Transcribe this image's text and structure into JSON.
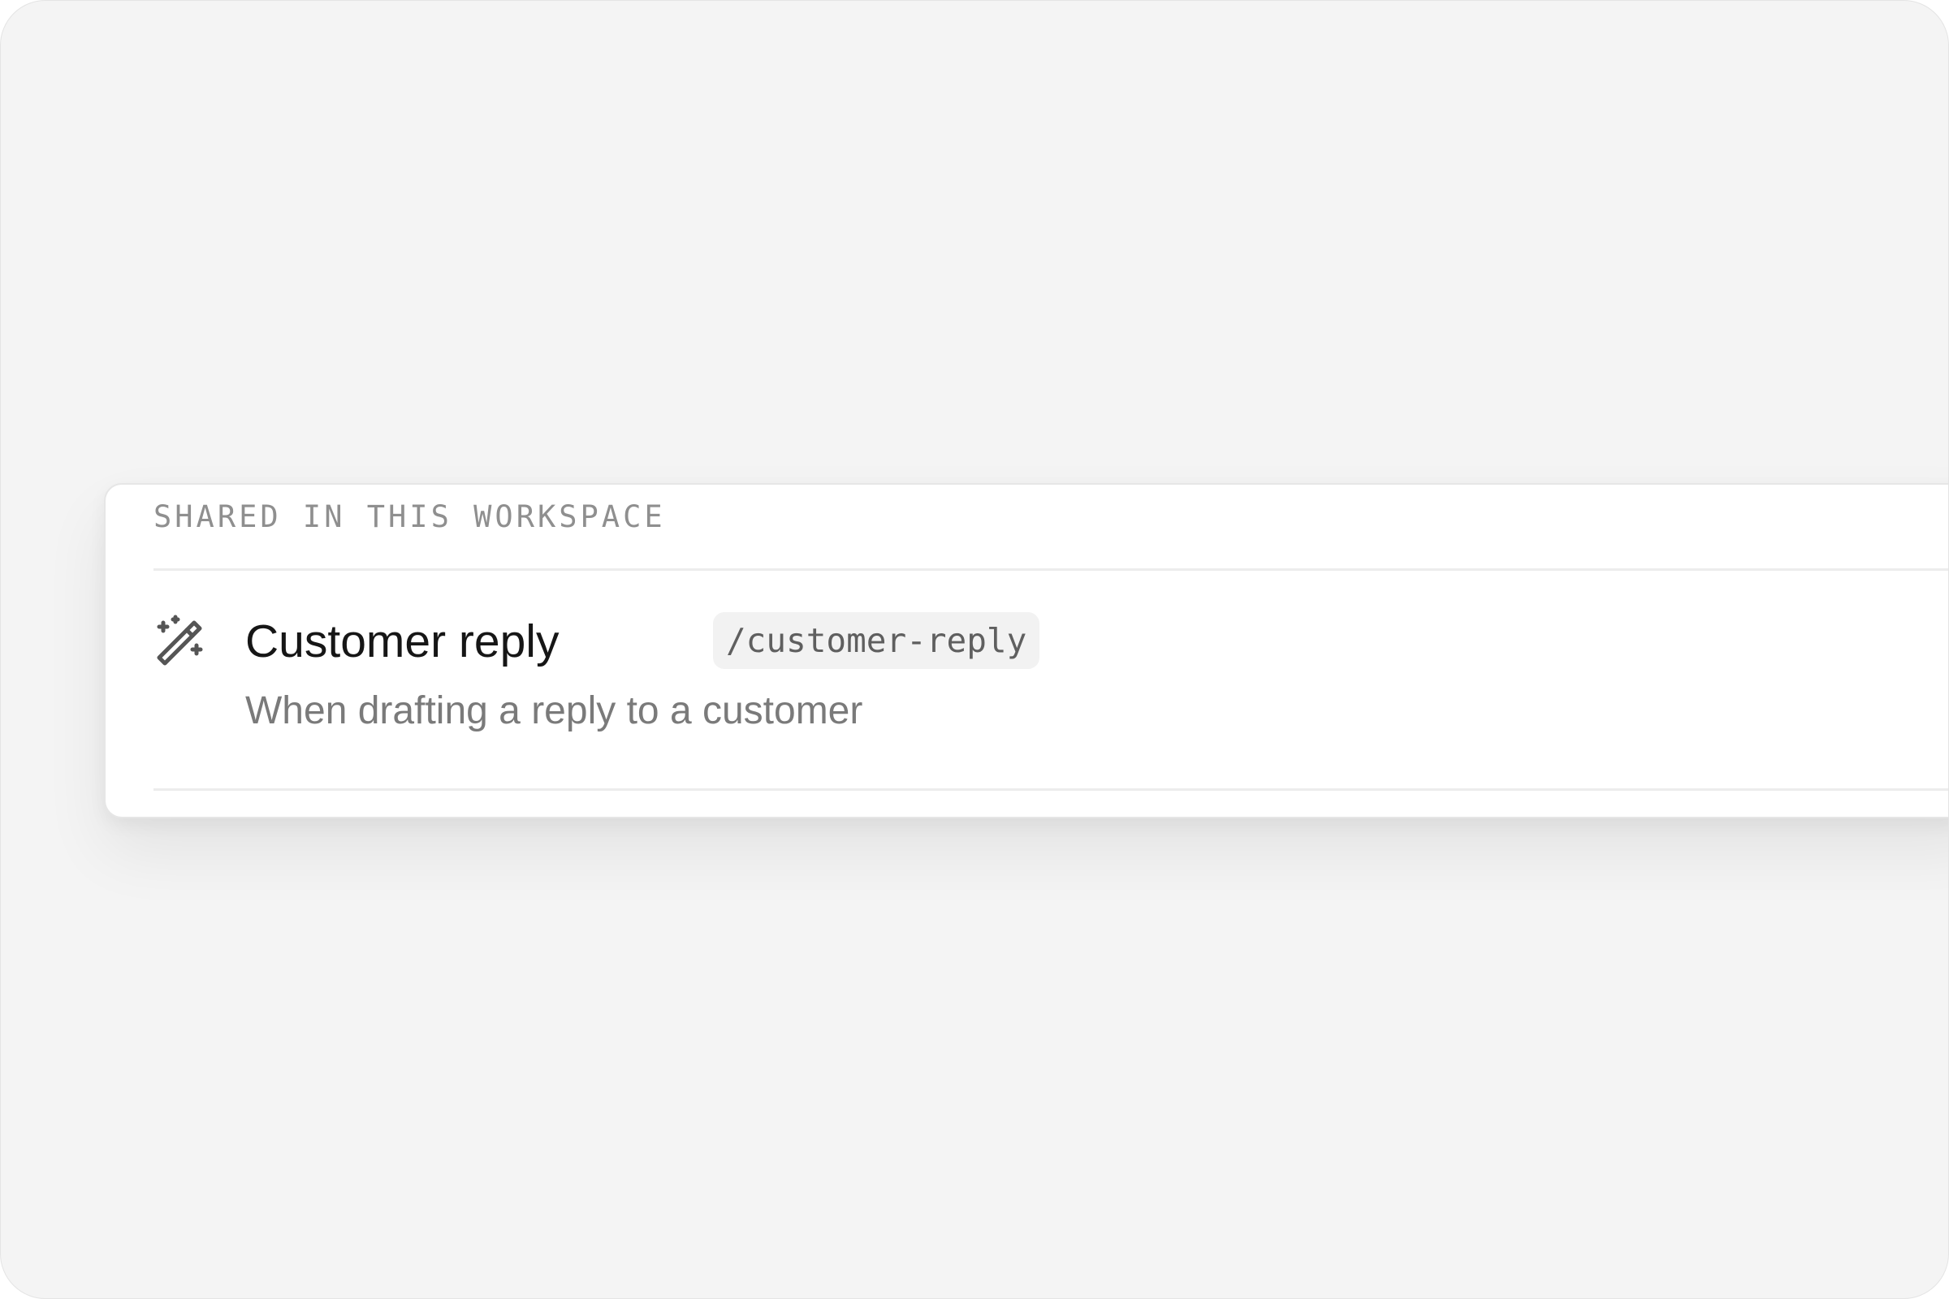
{
  "section": {
    "label": "SHARED IN THIS WORKSPACE"
  },
  "skills": [
    {
      "icon": "magic-wand-sparkles-icon",
      "title": "Customer reply",
      "command": "/customer-reply",
      "description": "When drafting a reply to a customer"
    }
  ],
  "colors": {
    "background": "#f4f4f4",
    "panel": "#ffffff",
    "title_text": "#161616",
    "muted_text": "#7a7a7a",
    "label_text": "#8f8f8f",
    "command_chip": "#f2f2f2"
  }
}
